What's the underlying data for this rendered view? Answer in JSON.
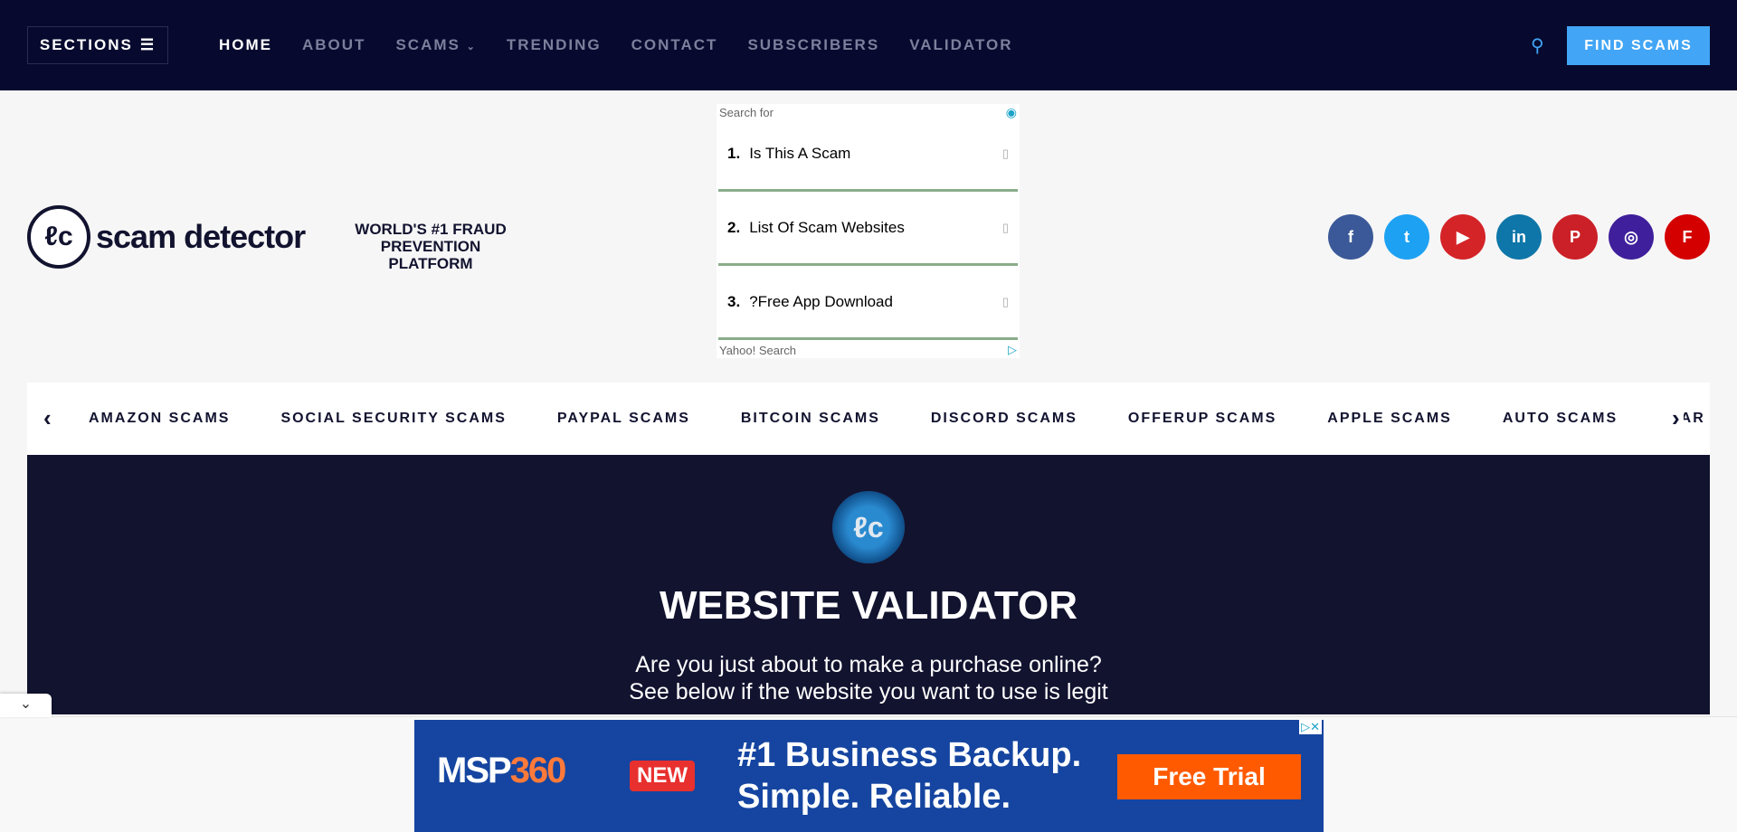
{
  "header": {
    "sections_label": "SECTIONS",
    "nav": [
      "HOME",
      "ABOUT",
      "SCAMS",
      "TRENDING",
      "CONTACT",
      "SUBSCRIBERS",
      "VALIDATOR"
    ],
    "find_label": "FIND SCAMS",
    "accent": "#42a5f5"
  },
  "brand": {
    "logo_text": "scam detector",
    "tagline": "WORLD'S #1 FRAUD PREVENTION PLATFORM"
  },
  "ad": {
    "search_for": "Search for",
    "items": [
      {
        "num": "1.",
        "label": "Is This A Scam"
      },
      {
        "num": "2.",
        "label": "List Of Scam Websites"
      },
      {
        "num": "3.",
        "label": "?Free App Download"
      }
    ],
    "footer": "Yahoo! Search"
  },
  "social": [
    {
      "name": "facebook",
      "glyph": "f",
      "color": "#3b5998"
    },
    {
      "name": "twitter",
      "glyph": "t",
      "color": "#1da1f2"
    },
    {
      "name": "youtube",
      "glyph": "▶",
      "color": "#d42428"
    },
    {
      "name": "linkedin",
      "glyph": "in",
      "color": "#0e76a8"
    },
    {
      "name": "pinterest",
      "glyph": "P",
      "color": "#cb2027"
    },
    {
      "name": "instagram",
      "glyph": "◎",
      "color": "#3f1f9b"
    },
    {
      "name": "flipboard",
      "glyph": "F",
      "color": "#d40000"
    }
  ],
  "categories": [
    "AMAZON SCAMS",
    "SOCIAL SECURITY SCAMS",
    "PAYPAL SCAMS",
    "BITCOIN SCAMS",
    "DISCORD SCAMS",
    "OFFERUP SCAMS",
    "APPLE SCAMS",
    "AUTO SCAMS",
    "CAR SCAMS"
  ],
  "hero": {
    "title": "WEBSITE VALIDATOR",
    "line1": "Are you just about to make a purchase online?",
    "line2": "See below if the website you want to use is legit"
  },
  "banner": {
    "brand": "MSP",
    "brand_num": "360",
    "badge": "NEW",
    "headline1": "#1 Business Backup.",
    "headline2": "Simple. Reliable.",
    "cta": "Free Trial"
  }
}
